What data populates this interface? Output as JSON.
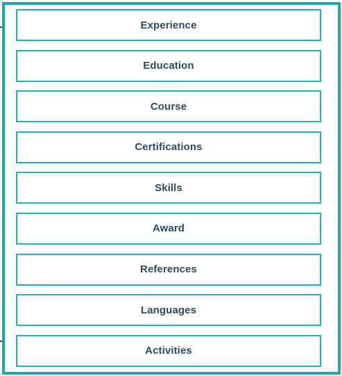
{
  "colors": {
    "frame_border": "#1aa8a8",
    "button_border": "#22b3b3",
    "label_text": "#2f4a5f",
    "background": "#ffffff"
  },
  "sections": [
    {
      "label": "Experience"
    },
    {
      "label": "Education"
    },
    {
      "label": "Course"
    },
    {
      "label": "Certifications"
    },
    {
      "label": "Skills"
    },
    {
      "label": "Award"
    },
    {
      "label": "References"
    },
    {
      "label": "Languages"
    },
    {
      "label": "Activities"
    }
  ]
}
